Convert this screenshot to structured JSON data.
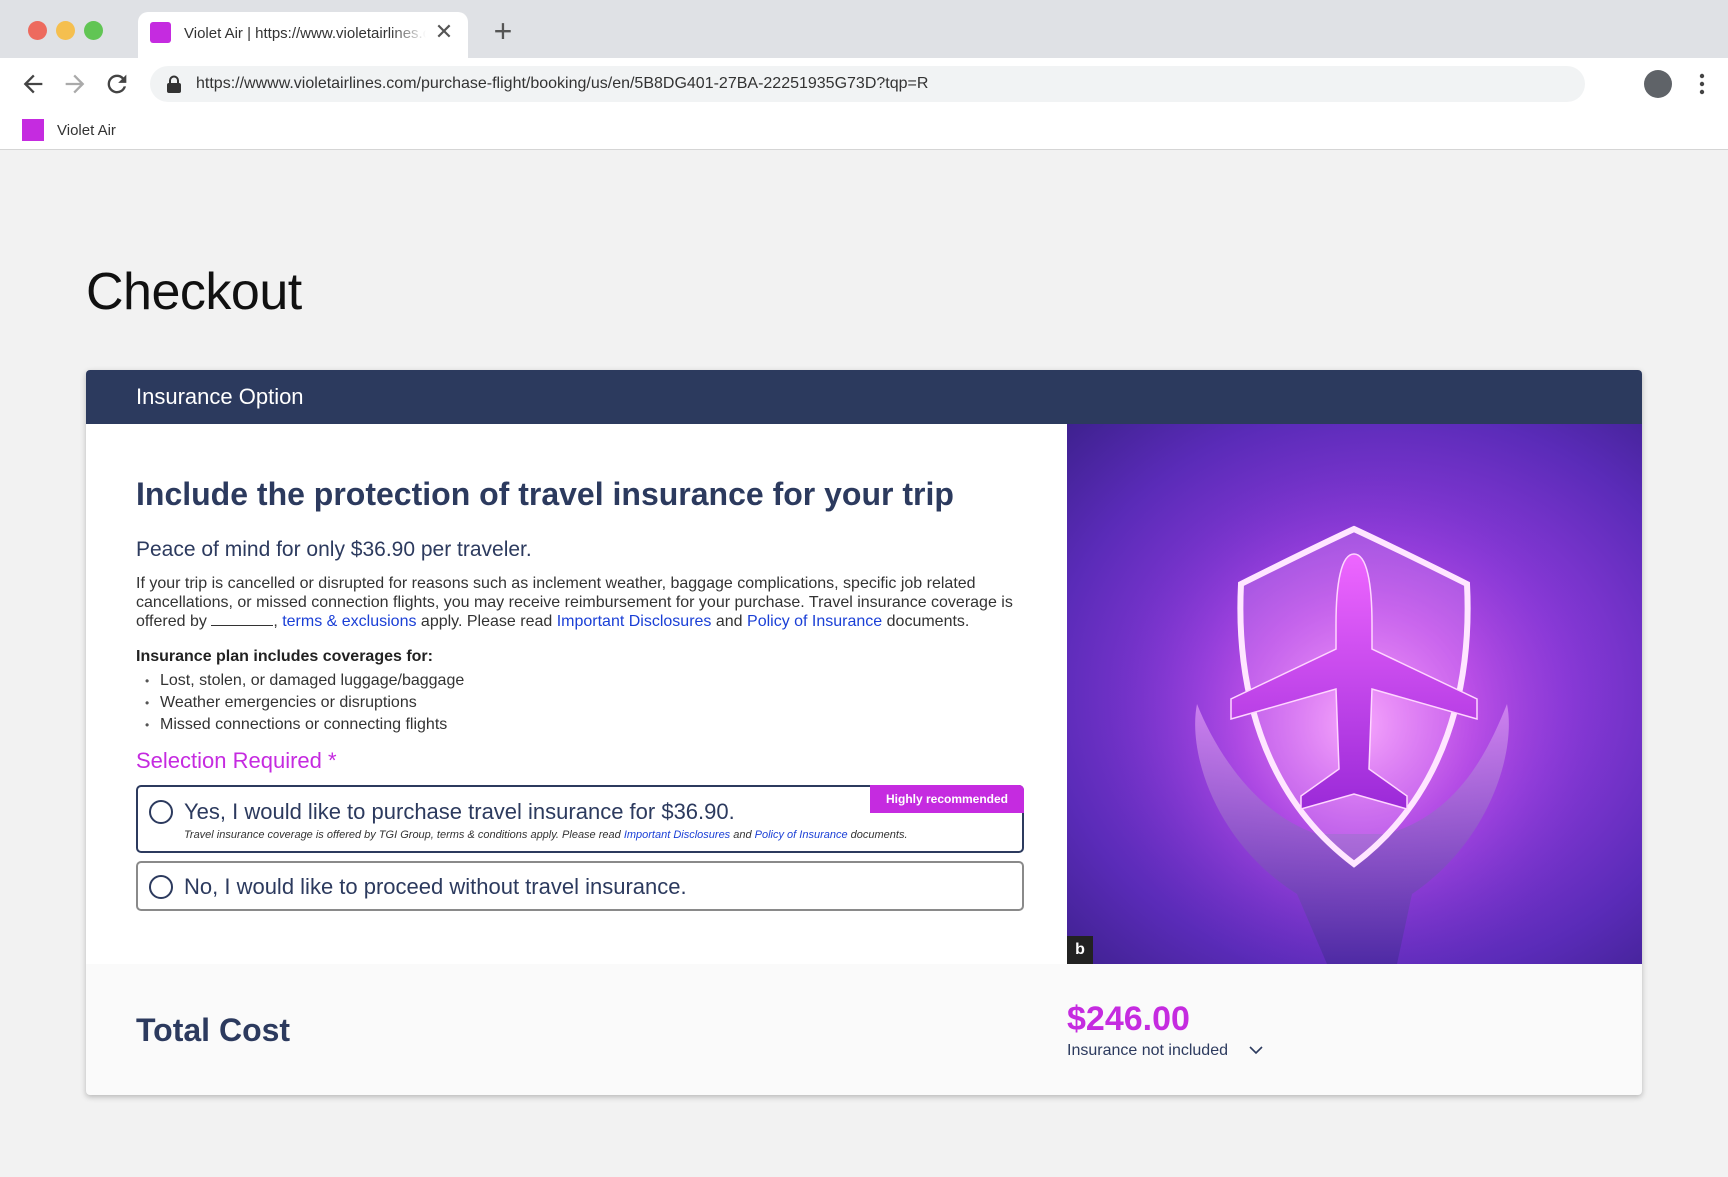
{
  "browser": {
    "tab_title": "Violet Air | https://www.violetairlines.com",
    "url": "https://wwww.violetairlines.com/purchase-flight/booking/us/en/5B8DG401-27BA-22251935G73D?tqp=R",
    "bookmark_label": "Violet Air",
    "favicon_color": "#c52be0"
  },
  "page": {
    "title": "Checkout"
  },
  "insurance": {
    "header": "Insurance Option",
    "headline": "Include the protection of travel insurance for your trip",
    "subhead": "Peace of mind for only $36.90 per traveler.",
    "description_before": "If your trip is cancelled or disrupted for reasons such as inclement weather, baggage complications, specific job related cancellations, or missed connection flights, you may receive reimbursement for your purchase. Travel insurance coverage is offered by ",
    "description_mid1": ", ",
    "link_terms": "terms & exclusions",
    "description_mid2": " apply. Please read ",
    "link_disclosures": "Important Disclosures",
    "description_and": " and ",
    "link_policy": "Policy of Insurance",
    "description_end": " documents.",
    "coverage_title": "Insurance plan includes coverages for:",
    "coverage_items": [
      "Lost, stolen, or damaged luggage/baggage",
      "Weather emergencies or disruptions",
      "Missed connections or connecting flights"
    ],
    "selection_required": "Selection Required *",
    "option_yes": {
      "label": "Yes, I would like to purchase travel insurance for $36.90.",
      "badge": "Highly recommended",
      "sub_before": "Travel insurance coverage is offered by TGI Group, terms & conditions apply. Please read ",
      "sub_link1": "Important Disclosures",
      "sub_and": " and ",
      "sub_link2": "Policy of Insurance",
      "sub_end": " documents."
    },
    "option_no": {
      "label": "No, I would like to proceed without travel insurance."
    },
    "image_badge": "b"
  },
  "total": {
    "label": "Total Cost",
    "price": "$246.00",
    "note": "Insurance not included"
  },
  "colors": {
    "navy": "#2c3a5e",
    "accent": "#c52be0",
    "link": "#1a3fd6"
  }
}
